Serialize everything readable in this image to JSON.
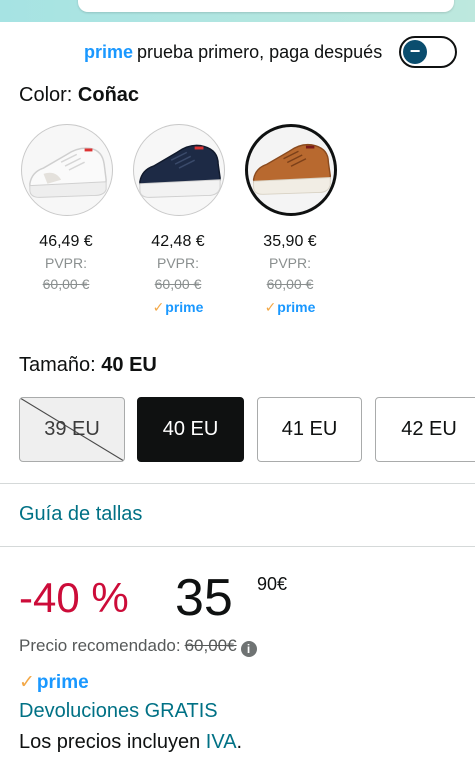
{
  "prime_trial": {
    "prime_word": "prime",
    "text": "prueba primero, paga después",
    "toggle_symbol": "−"
  },
  "color": {
    "label": "Color:",
    "selected": "Coñac"
  },
  "variants": [
    {
      "name": "white-sneaker",
      "price": "46,49 €",
      "rrp_label": "PVPR:",
      "rrp": "60,00 €",
      "prime": "",
      "swatch_color": "#ffffff"
    },
    {
      "name": "navy-sneaker",
      "price": "42,48 €",
      "rrp_label": "PVPR:",
      "rrp": "60,00 €",
      "prime": "prime",
      "swatch_color": "#1d2a45"
    },
    {
      "name": "cognac-sneaker",
      "price": "35,90 €",
      "rrp_label": "PVPR:",
      "rrp": "60,00 €",
      "prime": "prime",
      "swatch_color": "#b8692f"
    }
  ],
  "size": {
    "label": "Tamaño:",
    "selected": "40 EU",
    "options": [
      "39 EU",
      "40 EU",
      "41 EU",
      "42 EU"
    ]
  },
  "size_guide": "Guía de tallas",
  "deal": {
    "discount": "-40 %",
    "price_whole": "35",
    "price_fraction": "90",
    "currency": "€"
  },
  "recommended": {
    "label": "Precio recomendado:",
    "value": "60,00€"
  },
  "prime_badge": "prime",
  "returns": "Devoluciones GRATIS",
  "vat": {
    "prefix": "Los precios incluyen ",
    "link": "IVA",
    "suffix": "."
  },
  "colors": {
    "accent_link": "#007185",
    "prime_blue": "#1a98ff",
    "deal_red": "#cc0c39",
    "check_orange": "#f3a847"
  }
}
